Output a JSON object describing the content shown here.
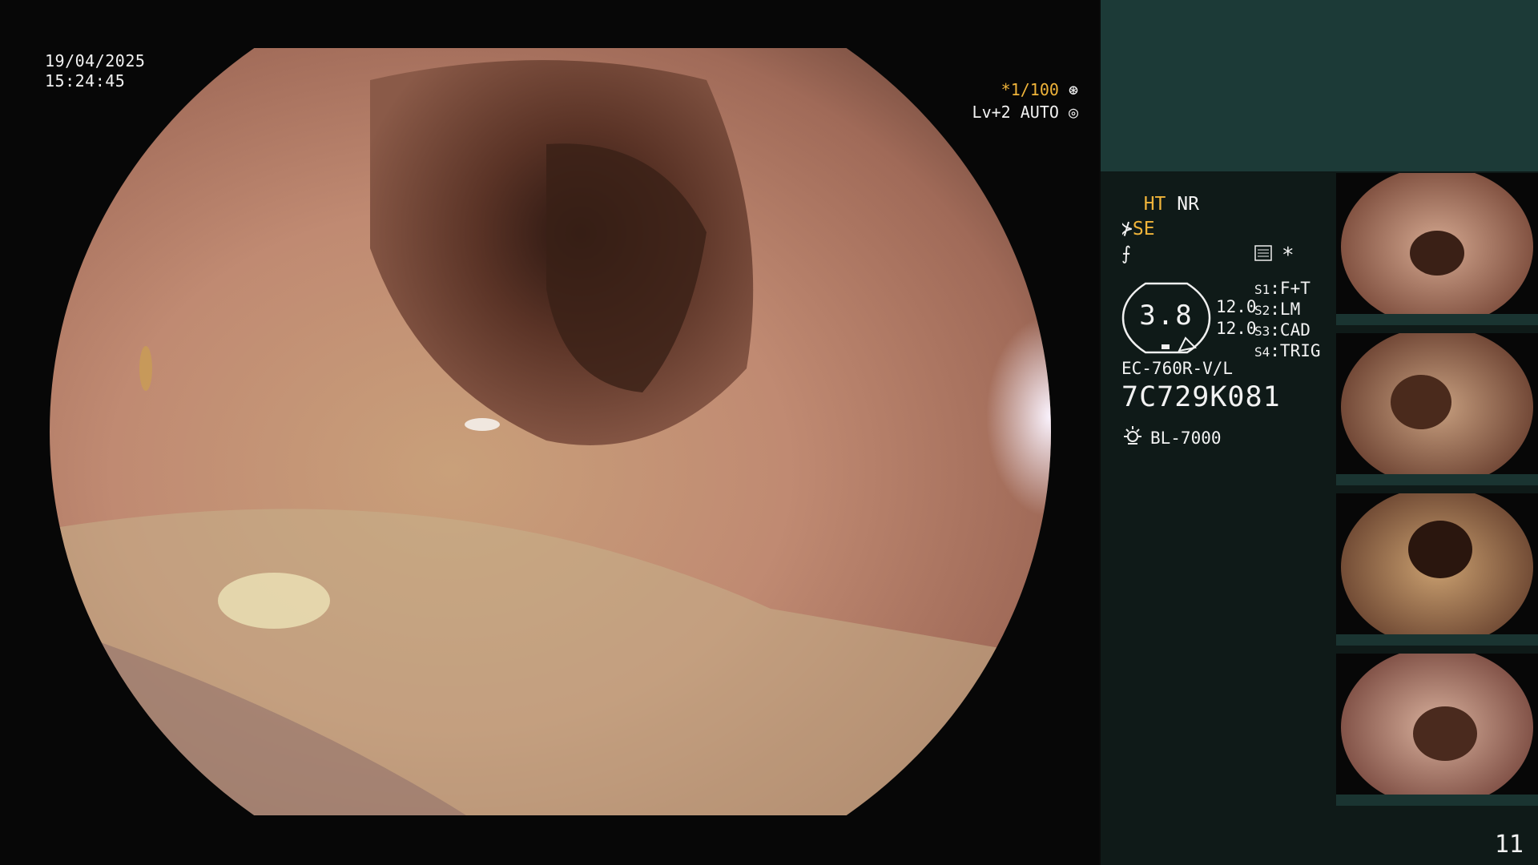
{
  "timestamp": {
    "date": "19/04/2025",
    "time": "15:24:45"
  },
  "overlay": {
    "shutter": "*1/100",
    "shutter_icon": "aperture-icon",
    "level": "Lv+2 AUTO",
    "level_icon": "iris-icon"
  },
  "panel": {
    "ht": "HT",
    "nr": "NR",
    "se": "SE",
    "gauge_value": "3.8",
    "nums": [
      "12.0",
      "12.0"
    ],
    "switches": [
      {
        "key": "S1",
        "label": "F+T"
      },
      {
        "key": "S2",
        "label": "LM"
      },
      {
        "key": "S3",
        "label": "CAD"
      },
      {
        "key": "S4",
        "label": "TRIG"
      }
    ],
    "star": "*",
    "scope_model": "EC-760R-V/L",
    "serial": "7C729K081",
    "light_source": "BL-7000"
  },
  "thumbnails": [
    {
      "name": "capture-1"
    },
    {
      "name": "capture-2"
    },
    {
      "name": "capture-3"
    },
    {
      "name": "capture-4"
    }
  ],
  "page_number": "11",
  "colors": {
    "panel_bg": "#0f1a18",
    "panel_top": "#1c3a37",
    "accent_amber": "#f0b43a"
  }
}
